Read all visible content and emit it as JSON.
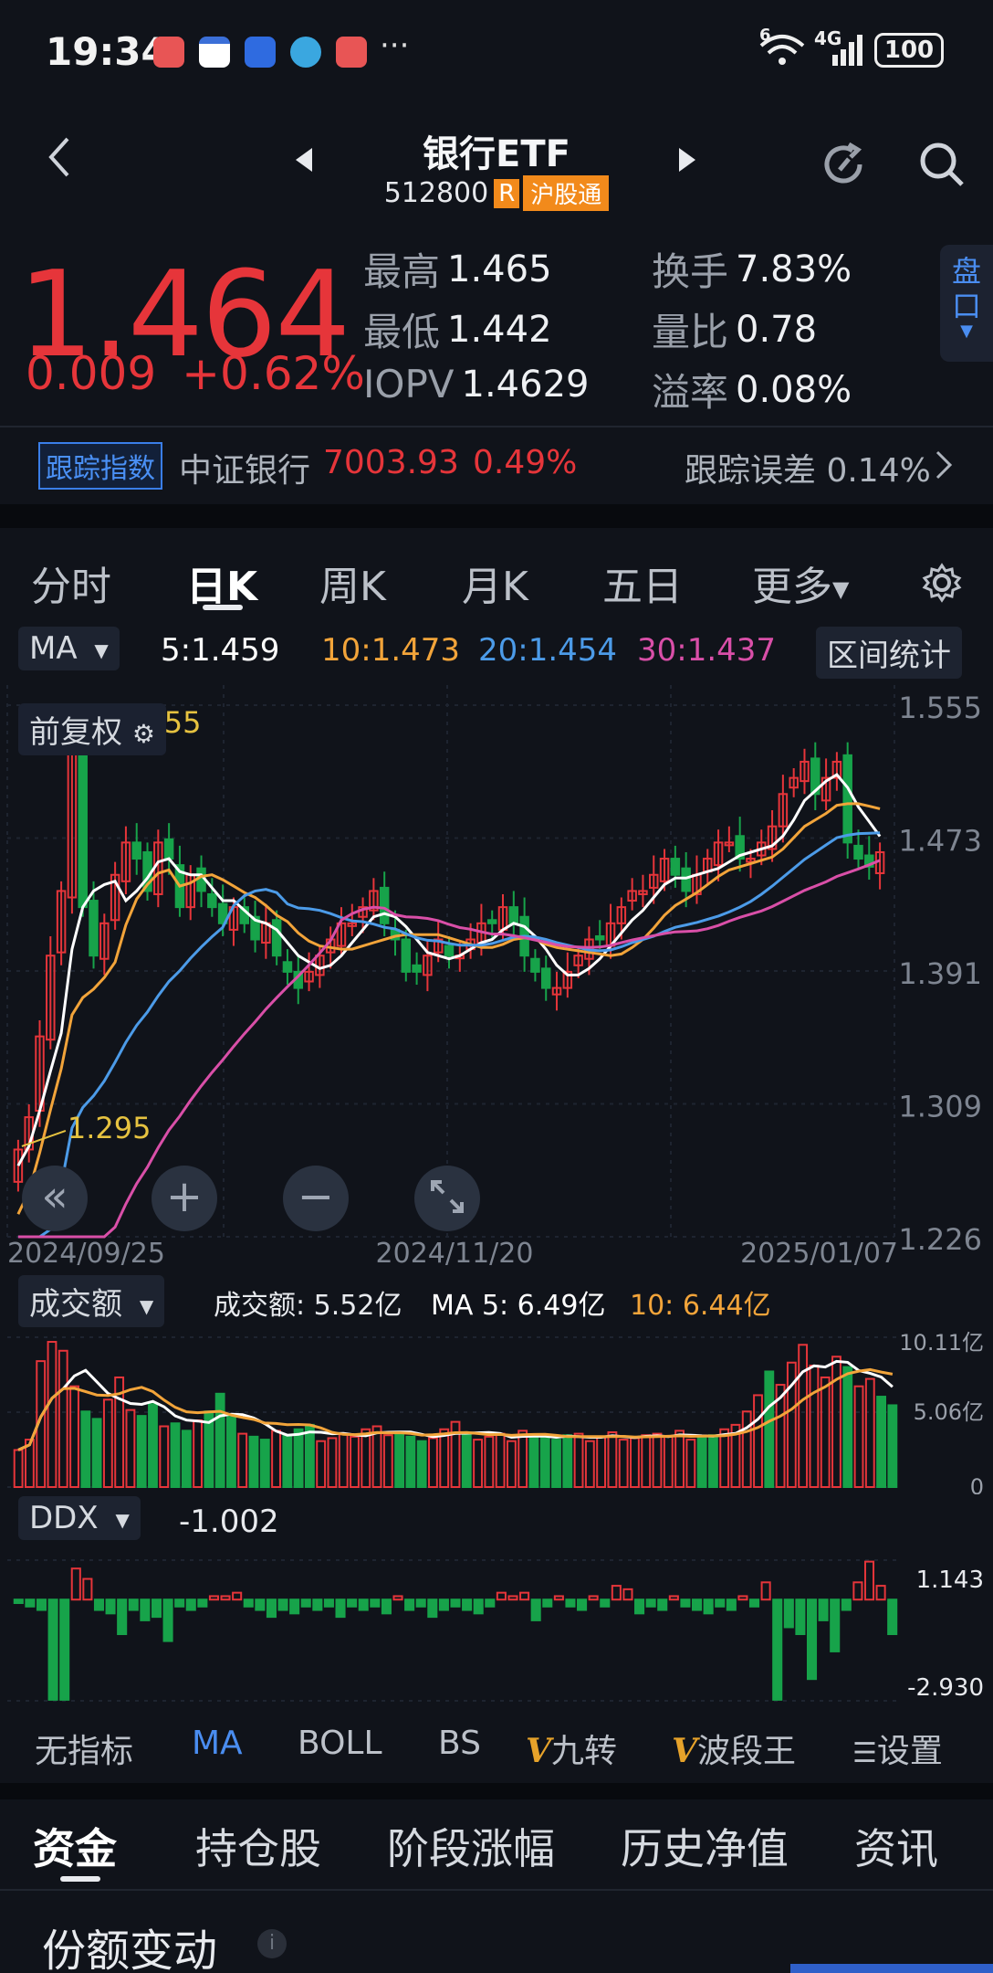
{
  "status_bar": {
    "time": "19:34",
    "more": "···",
    "signal": "4G",
    "wifi": "6",
    "battery": "100"
  },
  "header": {
    "title": "银行ETF",
    "code": "512800",
    "tag_r": "R",
    "tag_hk": "沪股通"
  },
  "quote": {
    "price": "1.464",
    "change": "0.009",
    "change_pct": "+0.62%",
    "stats": [
      {
        "label": "最高",
        "value": "1.465"
      },
      {
        "label": "换手",
        "value": "7.83%"
      },
      {
        "label": "最低",
        "value": "1.442"
      },
      {
        "label": "量比",
        "value": "0.78"
      },
      {
        "label": "IOPV",
        "value": "1.4629"
      },
      {
        "label": "溢率",
        "value": "0.08%"
      }
    ],
    "pankou": "盘口"
  },
  "tracking": {
    "tag": "跟踪指数",
    "index_name": "中证银行",
    "index_value": "7003.93",
    "index_pct": "0.49%",
    "error": "跟踪误差 0.14%"
  },
  "period_tabs": [
    "分时",
    "日K",
    "周K",
    "月K",
    "五日",
    "更多"
  ],
  "ma_bar": {
    "selector": "MA",
    "ma5": "5:1.459",
    "ma10": "10:1.473",
    "ma20": "20:1.454",
    "ma30": "30:1.437",
    "stats_button": "区间统计",
    "adjust": "前复权"
  },
  "colors": {
    "up": "#e6353a",
    "down": "#17a34a",
    "ma5": "#ffffff",
    "ma10": "#f2a43a",
    "ma20": "#4c9be8",
    "ma30": "#d94fa8"
  },
  "kline": {
    "y_ticks": [
      "1.555",
      "1.473",
      "1.391",
      "1.309",
      "1.226"
    ],
    "x_labels": [
      "2024/09/25",
      "2024/11/20",
      "2025/01/07"
    ],
    "high_mark": "1.555",
    "low_mark": "1.295"
  },
  "volume": {
    "selector": "成交额",
    "label": "成交额: 5.52亿",
    "ma5": "MA 5: 6.49亿",
    "ma10": "10: 6.44亿",
    "y_ticks": [
      "10.11亿",
      "5.06亿",
      "0"
    ]
  },
  "ddx": {
    "selector": "DDX",
    "value": "-1.002",
    "y_ticks": [
      "1.143",
      "-2.930"
    ]
  },
  "indicators": [
    "无指标",
    "MA",
    "BOLL",
    "BS",
    "九转",
    "波段王",
    "设置"
  ],
  "bottom_tabs": [
    "资金",
    "持仓股",
    "阶段涨幅",
    "历史净值",
    "资讯"
  ],
  "section_title": "份额变动",
  "chart_data": [
    {
      "type": "candlestick",
      "title": "",
      "ylim": [
        1.226,
        1.555
      ],
      "x_labels": [
        "2024/09/25",
        "2024/11/20",
        "2025/01/07"
      ],
      "series": [
        {
          "name": "5",
          "last": 1.459
        },
        {
          "name": "10",
          "last": 1.473
        },
        {
          "name": "20",
          "last": 1.454
        },
        {
          "name": "30",
          "last": 1.437
        }
      ],
      "annotations": {
        "high": 1.555,
        "low": 1.295
      },
      "closes": [
        1.28,
        1.3,
        1.35,
        1.4,
        1.44,
        1.53,
        1.43,
        1.4,
        1.42,
        1.45,
        1.47,
        1.46,
        1.44,
        1.47,
        1.46,
        1.43,
        1.45,
        1.44,
        1.43,
        1.42,
        1.43,
        1.42,
        1.41,
        1.42,
        1.4,
        1.39,
        1.38,
        1.39,
        1.4,
        1.41,
        1.42,
        1.42,
        1.43,
        1.44,
        1.42,
        1.41,
        1.39,
        1.39,
        1.4,
        1.41,
        1.4,
        1.4,
        1.41,
        1.42,
        1.42,
        1.43,
        1.42,
        1.4,
        1.39,
        1.38,
        1.38,
        1.39,
        1.4,
        1.41,
        1.41,
        1.42,
        1.43,
        1.44,
        1.44,
        1.45,
        1.46,
        1.45,
        1.44,
        1.45,
        1.46,
        1.47,
        1.47,
        1.46,
        1.46,
        1.47,
        1.48,
        1.5,
        1.51,
        1.52,
        1.5,
        1.51,
        1.52,
        1.47,
        1.46,
        1.455,
        1.464
      ]
    },
    {
      "type": "bar",
      "title": "",
      "ylim": [
        0,
        10.11
      ],
      "series": [
        {
          "name": "成交额",
          "last": 5.52
        },
        {
          "name": "MA 5",
          "last": 6.49
        },
        {
          "name": "10",
          "last": 6.44
        }
      ],
      "values": [
        2.5,
        3.2,
        8.5,
        9.8,
        9.2,
        6.8,
        5.1,
        4.6,
        5.9,
        7.4,
        5.2,
        4.8,
        5.6,
        4.1,
        4.3,
        3.8,
        4.5,
        5.1,
        6.3,
        4.9,
        3.6,
        3.4,
        3.2,
        3.8,
        3.5,
        3.9,
        4.2,
        3.1,
        3.3,
        3.6,
        3.4,
        3.9,
        4.1,
        3.5,
        3.7,
        3.4,
        3.1,
        3.3,
        3.9,
        4.4,
        3.5,
        3.2,
        3.4,
        3.6,
        3.1,
        3.8,
        3.3,
        3.4,
        3.2,
        3.5,
        3.6,
        3.1,
        3.4,
        3.7,
        3.2,
        3.3,
        3.5,
        3.6,
        3.4,
        3.8,
        3.2,
        3.3,
        3.5,
        3.9,
        4.2,
        5.1,
        6.2,
        7.8,
        6.9,
        8.4,
        9.6,
        8.2,
        7.4,
        8.8,
        8.1,
        6.8,
        7.3,
        6.1,
        5.52
      ]
    },
    {
      "type": "bar",
      "title": "",
      "ylim": [
        -2.93,
        1.143
      ],
      "series": [
        {
          "name": "DDX",
          "last": -1.002
        }
      ],
      "values": [
        -0.1,
        -0.2,
        -0.3,
        -2.9,
        -2.9,
        0.9,
        0.6,
        -0.3,
        -0.4,
        -1.0,
        -0.3,
        -0.6,
        -0.5,
        -1.2,
        -0.2,
        -0.3,
        -0.2,
        0.1,
        0.1,
        0.2,
        -0.2,
        -0.3,
        -0.5,
        -0.3,
        -0.4,
        -0.2,
        -0.3,
        -0.2,
        -0.5,
        -0.2,
        -0.3,
        -0.2,
        -0.4,
        0.1,
        -0.3,
        -0.2,
        -0.5,
        -0.3,
        -0.2,
        -0.3,
        -0.4,
        -0.2,
        0.2,
        0.1,
        0.2,
        -0.6,
        -0.2,
        0.1,
        -0.2,
        -0.3,
        0.1,
        -0.2,
        0.4,
        0.3,
        -0.4,
        -0.2,
        -0.3,
        0.1,
        -0.2,
        -0.3,
        -0.4,
        -0.2,
        -0.3,
        0.1,
        -0.2,
        0.5,
        -2.9,
        -0.8,
        -1.0,
        -2.3,
        -0.6,
        -1.5,
        -0.3,
        0.5,
        1.1,
        0.4,
        -1.0
      ]
    }
  ]
}
